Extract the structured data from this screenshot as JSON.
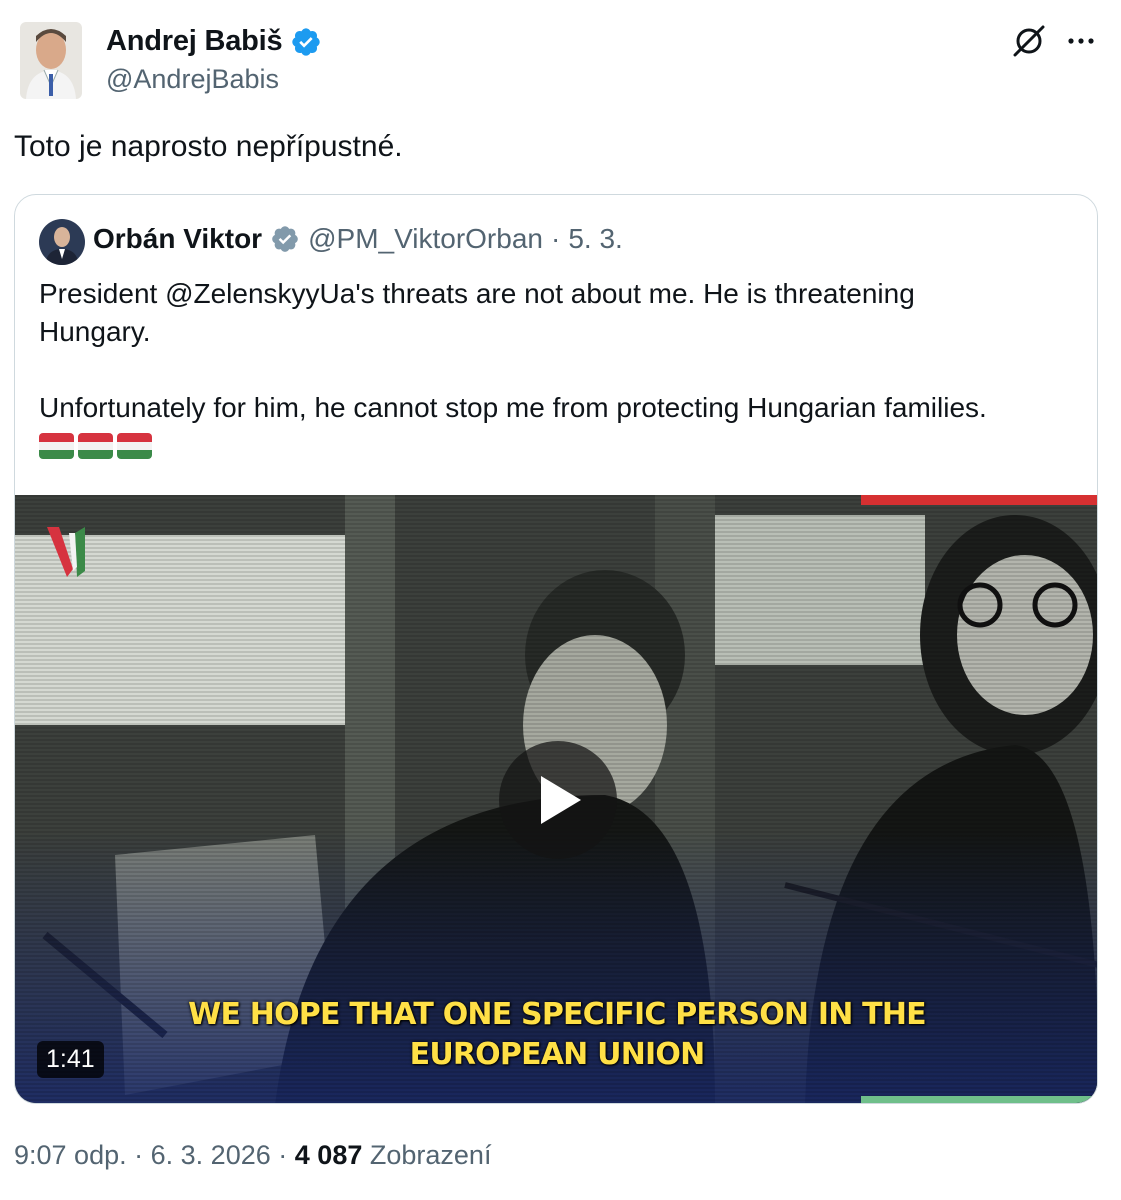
{
  "author": {
    "name": "Andrej Babiš",
    "handle": "@AndrejBabis",
    "verified_color": "#1d9bf0"
  },
  "tweet": {
    "text": "Toto je naprosto nepřípustné."
  },
  "quoted": {
    "name": "Orbán Viktor",
    "handle": "@PM_ViktorOrban",
    "separator": "·",
    "date": "5. 3.",
    "verified_color": "#829aab",
    "text_line1": "President @ZelenskyyUa's threats are not about me. He is threatening Hungary.",
    "text_line2": "Unfortunately for him, he cannot stop me from protecting Hungarian families.",
    "flags": [
      "hungary-flag",
      "hungary-flag",
      "hungary-flag"
    ],
    "video": {
      "subtitle_line1": "WE HOPE THAT ONE SPECIFIC PERSON IN THE",
      "subtitle_line2": "EUROPEAN UNION",
      "duration": "1:41",
      "subtitle_color": "#ffe046"
    }
  },
  "footer": {
    "time": "9:07 odp.",
    "separator1": "·",
    "date": "6. 3. 2026",
    "separator2": "·",
    "views_count": "4 087",
    "views_label": "Zobrazení"
  },
  "icons": {
    "grok": "grok-icon",
    "more": "more-icon",
    "play": "play-icon"
  }
}
